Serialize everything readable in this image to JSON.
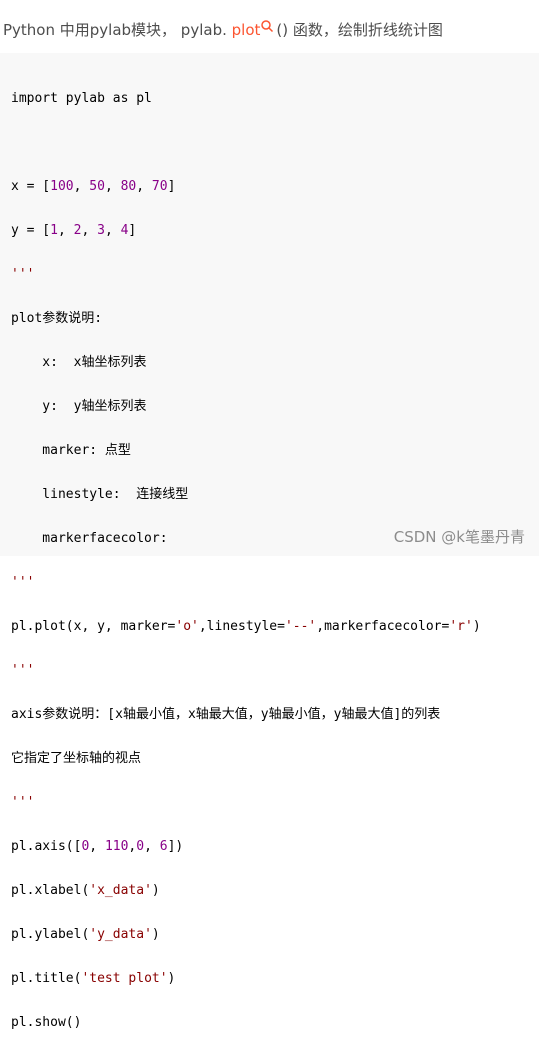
{
  "intro": {
    "prefix": "Python 中用pylab模块， pylab. ",
    "keyword": "plot",
    "suffix": "() 函数，绘制折线统计图"
  },
  "code": {
    "l1": "import pylab as pl",
    "l3_a": "x = [",
    "x_vals": [
      "100",
      "50",
      "80",
      "70"
    ],
    "l4_a": "y = [",
    "y_vals": [
      "1",
      "2",
      "3",
      "4"
    ],
    "quote": "'''",
    "l6": "plot参数说明:",
    "l7": "    x:  x轴坐标列表",
    "l8": "    y:  y轴坐标列表",
    "l9": "    marker: 点型",
    "l10": "    linestyle:  连接线型",
    "l11": "    markerfacecolor:",
    "l13_a": "pl.plot(x, y, marker=",
    "l13_s1": "'o'",
    "l13_b": ",linestyle=",
    "l13_s2": "'--'",
    "l13_c": ",markerfacecolor=",
    "l13_s3": "'r'",
    "l13_d": ")",
    "l15": "axis参数说明：[x轴最小值，x轴最大值，y轴最小值，y轴最大值]的列表",
    "l16": "它指定了坐标轴的视点",
    "l18_a": "pl.axis([",
    "axis_vals": [
      "0",
      "110",
      "0",
      "6"
    ],
    "l18_b": "])",
    "l19_a": "pl.xlabel(",
    "l19_s": "'x_data'",
    "l20_a": "pl.ylabel(",
    "l20_s": "'y_data'",
    "l21_a": "pl.title(",
    "l21_s": "'test plot'",
    "close": ")",
    "l22": "pl.show()"
  },
  "watermark": "CSDN @k笔墨丹青",
  "colors": {
    "keyword": "#fc5531",
    "number": "#880088",
    "string": "#880000"
  }
}
